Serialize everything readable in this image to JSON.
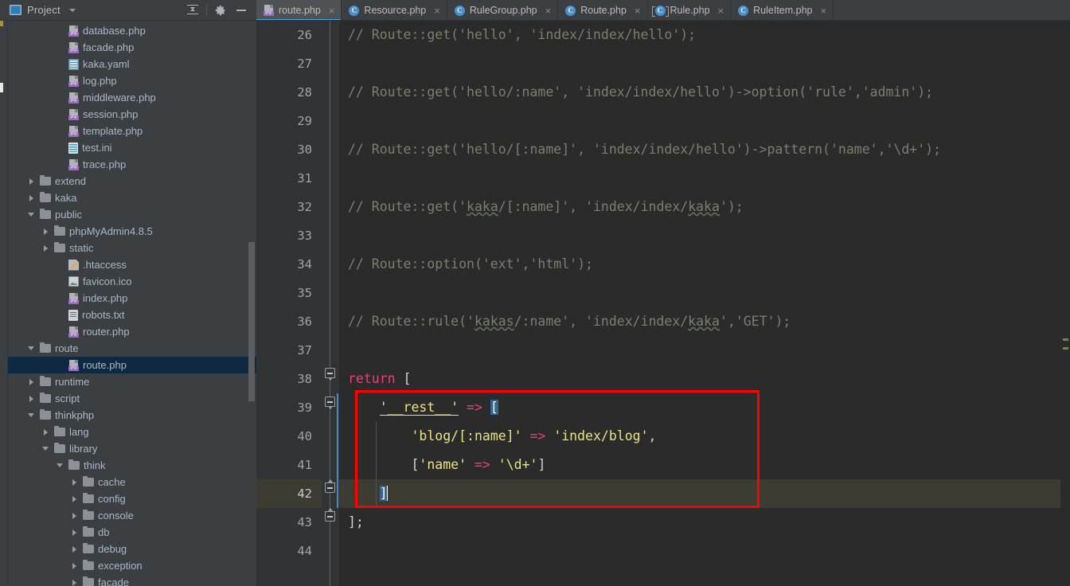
{
  "window": {
    "project_panel": {
      "title": "Project",
      "window_icon": "project-window-icon",
      "dropdown_icon": "chevron-down-icon",
      "collapse_all_icon": "collapse-all-icon",
      "settings_icon": "gear-icon",
      "hide_icon": "minimize-icon"
    }
  },
  "tabs": [
    {
      "label": "route.php",
      "icon": "php-file-icon",
      "active": true,
      "close": "×"
    },
    {
      "label": "Resource.php",
      "icon": "php-class-icon",
      "active": false,
      "close": "×"
    },
    {
      "label": "RuleGroup.php",
      "icon": "php-class-icon",
      "active": false,
      "close": "×"
    },
    {
      "label": "Route.php",
      "icon": "php-class-icon",
      "active": false,
      "close": "×"
    },
    {
      "label": "Rule.php",
      "icon": "php-abstract-class-icon",
      "active": false,
      "close": "×"
    },
    {
      "label": "RuleItem.php",
      "icon": "php-class-icon",
      "active": false,
      "close": "×"
    }
  ],
  "tree": [
    {
      "label": "database.php",
      "depth": 3,
      "type": "php",
      "toggle": "none",
      "selected": false
    },
    {
      "label": "facade.php",
      "depth": 3,
      "type": "php",
      "toggle": "none",
      "selected": false
    },
    {
      "label": "kaka.yaml",
      "depth": 3,
      "type": "yaml",
      "toggle": "none",
      "selected": false
    },
    {
      "label": "log.php",
      "depth": 3,
      "type": "php",
      "toggle": "none",
      "selected": false
    },
    {
      "label": "middleware.php",
      "depth": 3,
      "type": "php",
      "toggle": "none",
      "selected": false
    },
    {
      "label": "session.php",
      "depth": 3,
      "type": "php",
      "toggle": "none",
      "selected": false
    },
    {
      "label": "template.php",
      "depth": 3,
      "type": "php",
      "toggle": "none",
      "selected": false
    },
    {
      "label": "test.ini",
      "depth": 3,
      "type": "ini",
      "toggle": "none",
      "selected": false
    },
    {
      "label": "trace.php",
      "depth": 3,
      "type": "php",
      "toggle": "none",
      "selected": false
    },
    {
      "label": "extend",
      "depth": 1,
      "type": "folder",
      "toggle": "closed",
      "selected": false
    },
    {
      "label": "kaka",
      "depth": 1,
      "type": "folder",
      "toggle": "closed",
      "selected": false
    },
    {
      "label": "public",
      "depth": 1,
      "type": "folder",
      "toggle": "open",
      "selected": false
    },
    {
      "label": "phpMyAdmin4.8.5",
      "depth": 2,
      "type": "folder",
      "toggle": "closed",
      "selected": false
    },
    {
      "label": "static",
      "depth": 2,
      "type": "folder",
      "toggle": "closed",
      "selected": false
    },
    {
      "label": ".htaccess",
      "depth": 3,
      "type": "htaccess",
      "toggle": "none",
      "selected": false
    },
    {
      "label": "favicon.ico",
      "depth": 3,
      "type": "image",
      "toggle": "none",
      "selected": false
    },
    {
      "label": "index.php",
      "depth": 3,
      "type": "php",
      "toggle": "none",
      "selected": false
    },
    {
      "label": "robots.txt",
      "depth": 3,
      "type": "text",
      "toggle": "none",
      "selected": false
    },
    {
      "label": "router.php",
      "depth": 3,
      "type": "php",
      "toggle": "none",
      "selected": false
    },
    {
      "label": "route",
      "depth": 1,
      "type": "folder",
      "toggle": "open",
      "selected": false
    },
    {
      "label": "route.php",
      "depth": 3,
      "type": "php",
      "toggle": "none",
      "selected": true
    },
    {
      "label": "runtime",
      "depth": 1,
      "type": "folder",
      "toggle": "closed",
      "selected": false
    },
    {
      "label": "script",
      "depth": 1,
      "type": "folder",
      "toggle": "closed",
      "selected": false
    },
    {
      "label": "thinkphp",
      "depth": 1,
      "type": "folder",
      "toggle": "open",
      "selected": false
    },
    {
      "label": "lang",
      "depth": 2,
      "type": "folder",
      "toggle": "closed",
      "selected": false
    },
    {
      "label": "library",
      "depth": 2,
      "type": "folder",
      "toggle": "open",
      "selected": false
    },
    {
      "label": "think",
      "depth": 3,
      "type": "folder",
      "toggle": "open",
      "selected": false
    },
    {
      "label": "cache",
      "depth": 4,
      "type": "folder",
      "toggle": "closed",
      "selected": false
    },
    {
      "label": "config",
      "depth": 4,
      "type": "folder",
      "toggle": "closed",
      "selected": false
    },
    {
      "label": "console",
      "depth": 4,
      "type": "folder",
      "toggle": "closed",
      "selected": false
    },
    {
      "label": "db",
      "depth": 4,
      "type": "folder",
      "toggle": "closed",
      "selected": false
    },
    {
      "label": "debug",
      "depth": 4,
      "type": "folder",
      "toggle": "closed",
      "selected": false
    },
    {
      "label": "exception",
      "depth": 4,
      "type": "folder",
      "toggle": "closed",
      "selected": false
    },
    {
      "label": "facade",
      "depth": 4,
      "type": "folder",
      "toggle": "closed",
      "selected": false
    }
  ],
  "editor": {
    "first_line_number": 26,
    "highlighted_line": 42,
    "lines": [
      {
        "n": 26,
        "text": "// Route::get('hello', 'index/index/hello');"
      },
      {
        "n": 27,
        "text": ""
      },
      {
        "n": 28,
        "text": "// Route::get('hello/:name', 'index/index/hello')->option('rule','admin');"
      },
      {
        "n": 29,
        "text": ""
      },
      {
        "n": 30,
        "text": "// Route::get('hello/[:name]', 'index/index/hello')->pattern('name','\\d+');"
      },
      {
        "n": 31,
        "text": ""
      },
      {
        "n": 32,
        "text": "// Route::get('kaka/[:name]', 'index/index/kaka');"
      },
      {
        "n": 33,
        "text": ""
      },
      {
        "n": 34,
        "text": "// Route::option('ext','html');"
      },
      {
        "n": 35,
        "text": ""
      },
      {
        "n": 36,
        "text": "// Route::rule('kakas/:name', 'index/index/kaka','GET');"
      },
      {
        "n": 37,
        "text": ""
      },
      {
        "n": 38,
        "text": "return ["
      },
      {
        "n": 39,
        "text": "    '__rest__' => ["
      },
      {
        "n": 40,
        "text": "        'blog/[:name]' => 'index/blog',"
      },
      {
        "n": 41,
        "text": "        ['name' => '\\d+']"
      },
      {
        "n": 42,
        "text": "    ]"
      },
      {
        "n": 43,
        "text": "];"
      },
      {
        "n": 44,
        "text": ""
      }
    ],
    "annotation": {
      "shape": "rectangle",
      "color": "#ff0000",
      "covers_lines": "39-42"
    },
    "colors": {
      "background": "#2b2b2b",
      "gutter": "#313335",
      "comment": "#7b7f6f",
      "keyword": "#e8407a",
      "string": "#e9e38a",
      "operator": "#e8407a",
      "selection": "#2f6598",
      "current_line": "#3c3c33",
      "change_bar": "#4a88c7",
      "accent": "#4aa8d8"
    }
  }
}
